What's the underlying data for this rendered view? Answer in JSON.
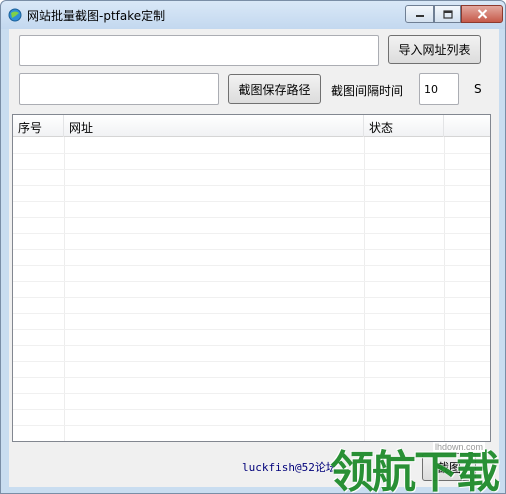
{
  "window": {
    "title": "网站批量截图-ptfake定制",
    "icon": "app-globe-icon",
    "controls": [
      "minimize-icon",
      "maximize-icon",
      "close-icon"
    ]
  },
  "toolbar": {
    "url_input_value": "",
    "import_button_label": "导入网址列表",
    "path_input_value": "",
    "save_path_button_label": "截图保存路径",
    "interval_label": "截图间隔时间",
    "interval_value": "10",
    "interval_unit": "S"
  },
  "table": {
    "columns": [
      "序号",
      "网址",
      "状态",
      ""
    ],
    "rows": []
  },
  "footer": {
    "credit": "luckfish@52论坛",
    "capture_button_label": "截图"
  },
  "watermark": {
    "text": "领航下载",
    "domain": "lhdown.com"
  },
  "colors": {
    "frame": "#c9ddf0",
    "client_bg": "#f0f0f0",
    "credit_text": "#00007a",
    "watermark": "#1f8b2c"
  }
}
